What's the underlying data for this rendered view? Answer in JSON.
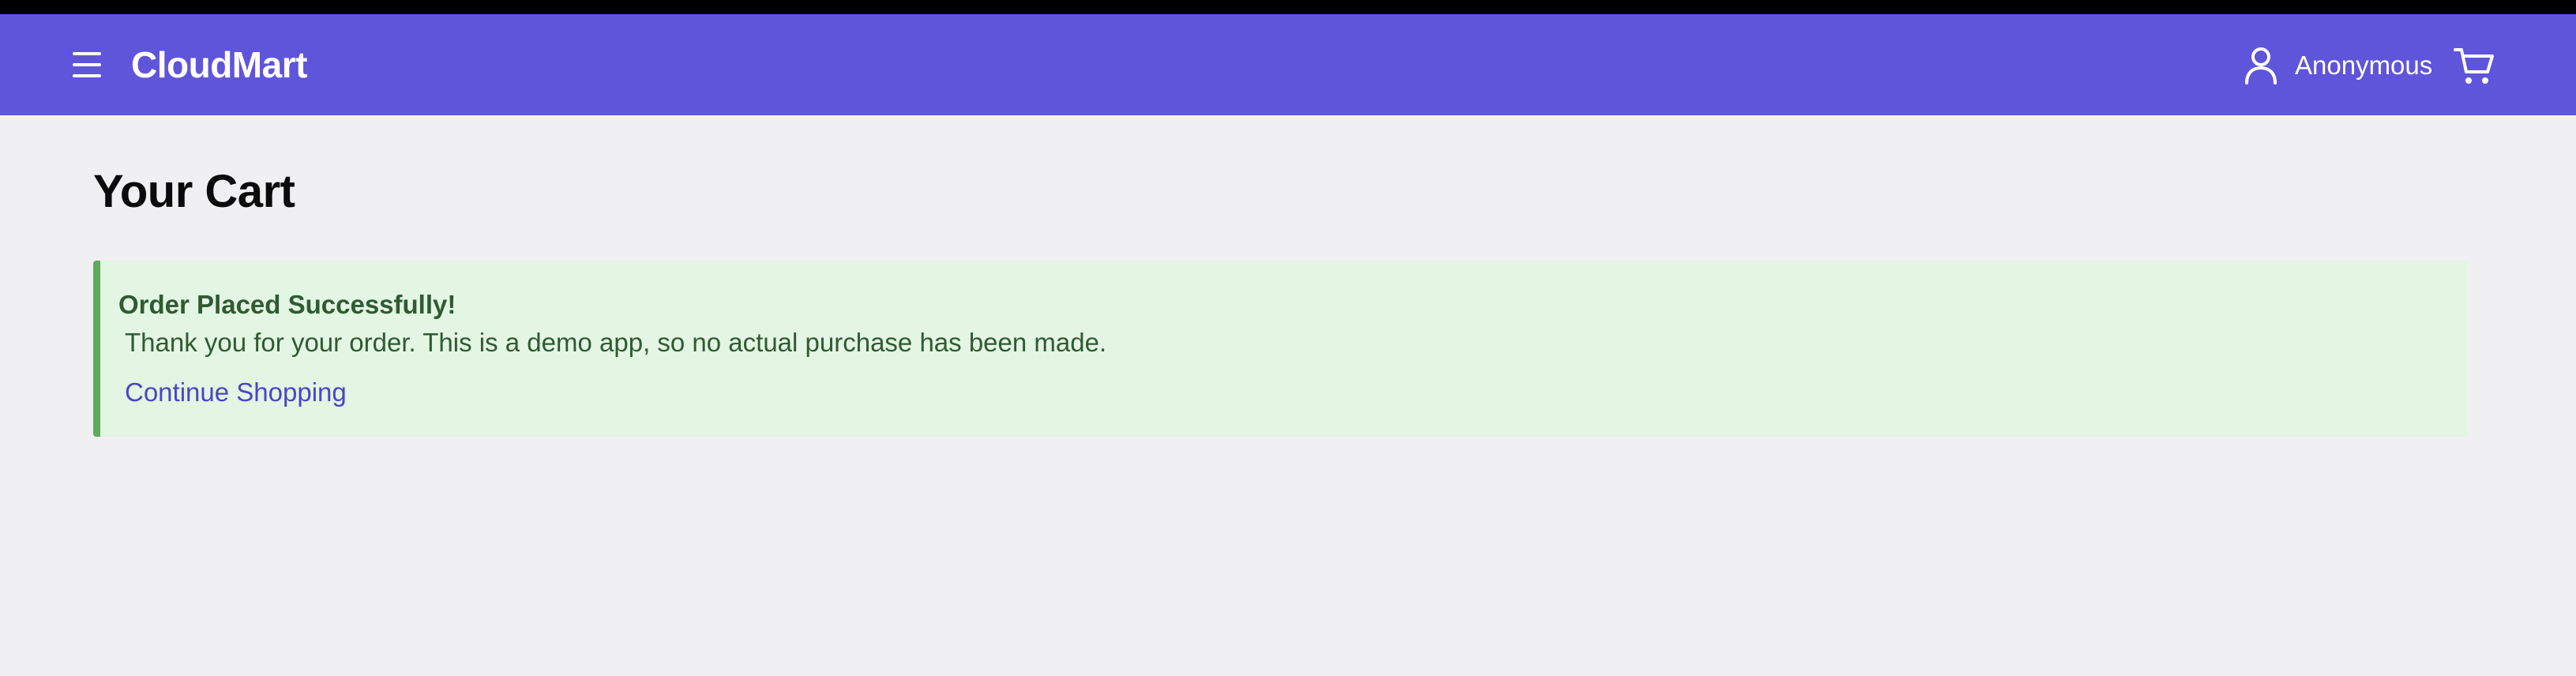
{
  "header": {
    "brand": "CloudMart",
    "menu_icon": "hamburger-menu-icon",
    "user_icon": "user-icon",
    "user_label": "Anonymous",
    "cart_icon": "shopping-cart-icon",
    "background_color": "#5f55db"
  },
  "main": {
    "title": "Your Cart",
    "alert": {
      "title": "Order Placed Successfully!",
      "message": "Thank you for your order. This is a demo app, so no actual purchase has been made.",
      "link_label": "Continue Shopping",
      "background_color": "#e3f5e3",
      "accent_color": "#5eab5e",
      "text_color": "#2f5a32",
      "link_color": "#4b45c6"
    }
  }
}
